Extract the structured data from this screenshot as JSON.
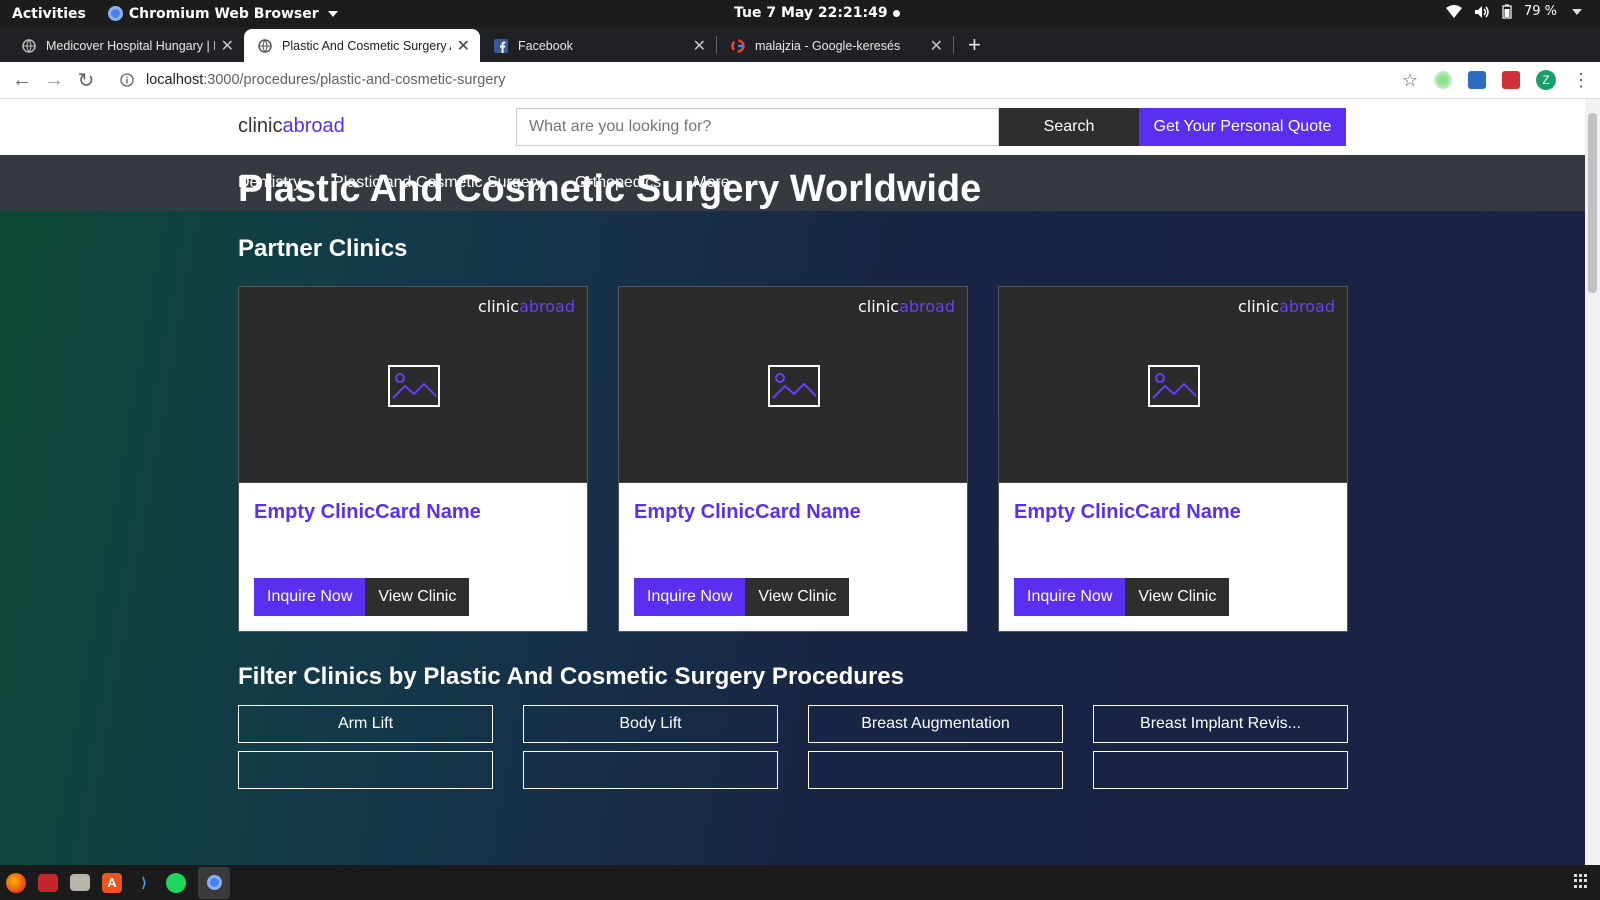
{
  "system": {
    "activities": "Activities",
    "app_name": "Chromium Web Browser",
    "clock": "Tue 7 May  22:21:49",
    "battery": "79 %"
  },
  "tabs": [
    {
      "title": "Medicover Hospital Hungary | B",
      "icon": "globe-icon",
      "active": false
    },
    {
      "title": "Plastic And Cosmetic Surgery Al",
      "icon": "globe-icon",
      "active": true
    },
    {
      "title": "Facebook",
      "icon": "facebook-icon",
      "active": false
    },
    {
      "title": "malajzia - Google-keresés",
      "icon": "google-icon",
      "active": false
    }
  ],
  "address_bar": {
    "host": "localhost",
    "path": ":3000/procedures/plastic-and-cosmetic-surgery"
  },
  "site": {
    "logo_prefix": "clinic",
    "logo_accent": "abroad",
    "search_placeholder": "What are you looking for?",
    "search_label": "Search",
    "quote_label": "Get Your Personal Quote",
    "nav": [
      "Dentistry",
      "Plastic and Cosmetic Surgery",
      "Orthopedics",
      "More"
    ]
  },
  "page": {
    "title": "Plastic And Cosmetic Surgery Worldwide",
    "partner_heading": "Partner Clinics",
    "filter_heading": "Filter Clinics by Plastic And Cosmetic Surgery Procedures"
  },
  "clinic_cards": [
    {
      "name": "Empty ClinicCard Name",
      "inquire_label": "Inquire Now",
      "view_label": "View Clinic"
    },
    {
      "name": "Empty ClinicCard Name",
      "inquire_label": "Inquire Now",
      "view_label": "View Clinic"
    },
    {
      "name": "Empty ClinicCard Name",
      "inquire_label": "Inquire Now",
      "view_label": "View Clinic"
    }
  ],
  "procedure_filters": [
    "Arm Lift",
    "Body Lift",
    "Breast Augmentation",
    "Breast Implant Revis..."
  ],
  "colors": {
    "brand": "#5b2ff0",
    "dark_button": "#2e2e2e",
    "nav_bar": "#343a40"
  }
}
